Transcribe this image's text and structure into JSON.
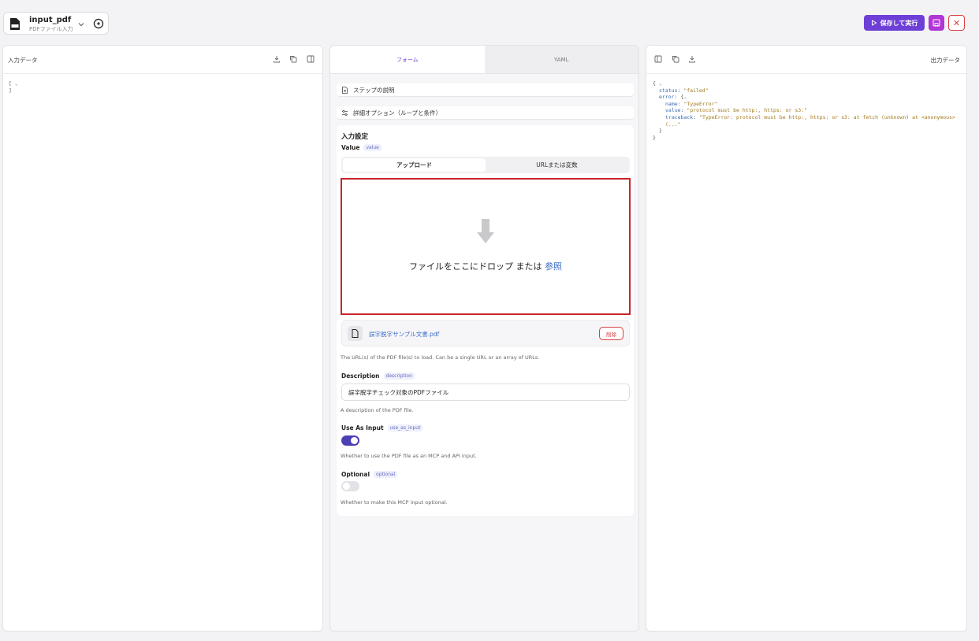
{
  "node": {
    "title": "input_pdf",
    "subtitle": "PDFファイル入力",
    "icon": "pdf-file-icon"
  },
  "actions": {
    "run_label": "保存して実行",
    "save_icon": "floppy-icon",
    "close_icon": "close-icon",
    "close_glyph": "✕"
  },
  "left_panel": {
    "title": "入力データ",
    "json_lines": [
      "[",
      "]"
    ],
    "chevron": "⌄"
  },
  "mid_panel": {
    "tabs": [
      "フォーム",
      "YAML"
    ],
    "step_description": "ステップの説明",
    "advanced_options": "詳細オプション（ループと条件）",
    "section_title": "入力設定",
    "value": {
      "label": "Value",
      "tag": "value",
      "upload_tabs": [
        "アップロード",
        "URLまたは変数"
      ],
      "drop_text": "ファイルをここにドロップ または ",
      "browse_link": "参照",
      "file_name": "誤字脱字サンプル文書.pdf",
      "delete_label": "削除",
      "help": "The URL(s) of the PDF file(s) to load. Can be a single URL or an array of URLs."
    },
    "description": {
      "label": "Description",
      "tag": "description",
      "value": "誤字脱字チェック対象のPDFファイル",
      "help": "A description of the PDF file."
    },
    "use_as_input": {
      "label": "Use As Input",
      "tag": "use_as_input",
      "checked": true,
      "help": "Whether to use the PDF file as an MCP and API input."
    },
    "optional": {
      "label": "Optional",
      "tag": "optional",
      "checked": false,
      "help": "Whether to make this MCP input optional."
    }
  },
  "right_panel": {
    "title": "出力データ",
    "json": {
      "status_key": "status",
      "status_val": "\"failed\"",
      "error_key": "error",
      "name_key": "name",
      "name_val": "\"TypeError\"",
      "value_key": "value",
      "value_val": "\"protocol must be http:, https: or s3:\"",
      "traceback_key": "traceback",
      "traceback_val": "\"TypeError: protocol must be http:, https: or s3: at fetch (unknown) at <anonymous>",
      "traceback_cont": "(...\""
    }
  },
  "colors": {
    "accent": "#6d3fd6",
    "save": "#b036d6",
    "danger": "#d94040",
    "link": "#3e6fc7",
    "toggle_on": "#4d3fb5"
  }
}
